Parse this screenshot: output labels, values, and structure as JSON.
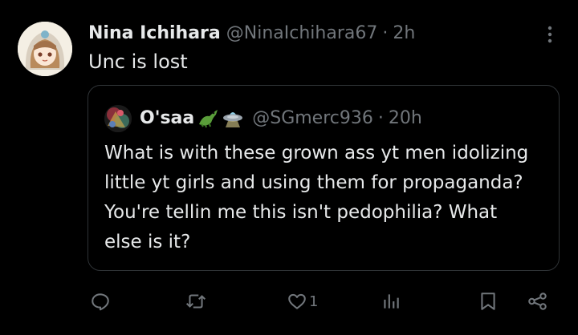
{
  "tweet": {
    "author_name": "Nina Ichihara",
    "author_handle": "@NinaIchihara67",
    "separator": "·",
    "time": "2h",
    "text": "Unc is lost",
    "avatar_icon": "anime-girl-avatar"
  },
  "quoted": {
    "author_name": "O'saa",
    "emojis": [
      "crocodile-emoji",
      "ufo-emoji"
    ],
    "author_handle": "@SGmerc936",
    "separator": "·",
    "time": "20h",
    "text": "What is with these grown ass yt men idolizing little yt girls and using them for propaganda? You're tellin me this isn't pedophilia? What else is it?",
    "avatar_icon": "abstract-art-avatar"
  },
  "actions": {
    "reply_icon": "reply-icon",
    "repost_icon": "repost-icon",
    "like_icon": "heart-icon",
    "like_count": "1",
    "views_icon": "views-icon",
    "bookmark_icon": "bookmark-icon",
    "share_icon": "share-icon"
  },
  "colors": {
    "background": "#000000",
    "text_primary": "#e7e9ea",
    "text_secondary": "#71767b",
    "border": "#2f3336"
  }
}
